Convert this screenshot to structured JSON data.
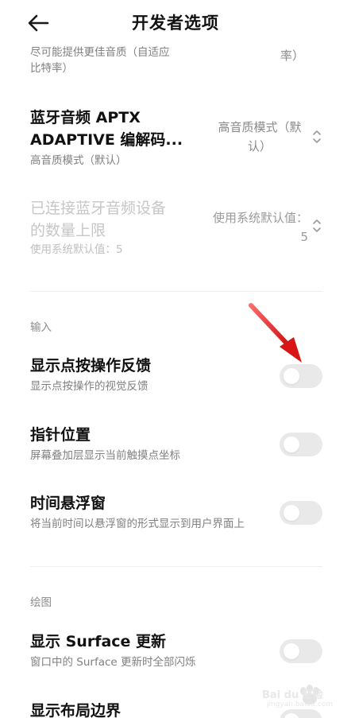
{
  "header": {
    "title": "开发者选项",
    "back_icon": "back-arrow-icon"
  },
  "settings": {
    "partial_top": {
      "sub_line1": "尽可能提供更佳音质（自适应",
      "sub_line2": "比特率）",
      "value_tail": "率）"
    },
    "aptx": {
      "title_line1": "蓝牙音频 APTX",
      "title_line2": "ADAPTIVE 编解码...",
      "sub": "高音质模式（默认）",
      "value_line1": "高音质模式（默",
      "value_line2": "认）"
    },
    "bt_max": {
      "title_line1": "已连接蓝牙音频设备",
      "title_line2": "的数量上限",
      "sub": "使用系统默认值：5",
      "value_line1": "使用系统默认值：",
      "value_line2": "5"
    },
    "input_section": "输入",
    "show_taps": {
      "title": "显示点按操作反馈",
      "sub": "显示点按操作的视觉反馈",
      "enabled": false
    },
    "pointer_location": {
      "title": "指针位置",
      "sub": "屏幕叠加层显示当前触摸点坐标",
      "enabled": false
    },
    "time_overlay": {
      "title": "时间悬浮窗",
      "sub": "将当前时间以悬浮窗的形式显示到用户界面上",
      "enabled": false
    },
    "drawing_section": "绘图",
    "surface_updates": {
      "title": "显示 Surface 更新",
      "sub": "窗口中的 Surface 更新时全部闪烁",
      "enabled": false
    },
    "layout_bounds": {
      "title": "显示布局边界"
    }
  },
  "colors": {
    "annotation_arrow": "#e02020",
    "toggle_off": "#e9e9e9"
  },
  "watermark": {
    "text": "Bai du 经验",
    "url": "jingyan.baidu.com"
  }
}
